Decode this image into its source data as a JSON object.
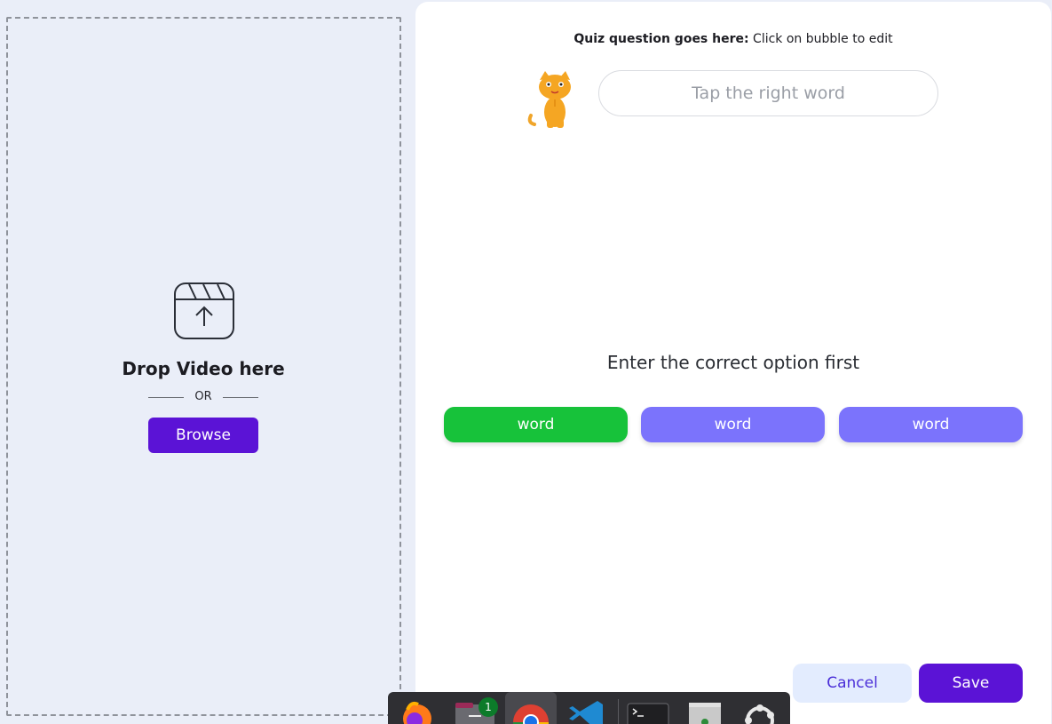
{
  "upload": {
    "title": "Drop Video here",
    "or_text": "OR",
    "browse_label": "Browse",
    "icon": "video-upload-icon"
  },
  "quiz": {
    "question_bold": "Quiz question goes here:",
    "question_rest": " Click on bubble to edit",
    "answer_placeholder": "Tap the right word",
    "hint": "Enter the correct option first",
    "options": [
      {
        "label": "word",
        "state": "correct",
        "color": "#17c23a"
      },
      {
        "label": "word",
        "state": "option",
        "color": "#7b73fc"
      },
      {
        "label": "word",
        "state": "option",
        "color": "#7b73fc"
      }
    ],
    "mascot": "cat-icon"
  },
  "actions": {
    "cancel_label": "Cancel",
    "save_label": "Save"
  },
  "dock": {
    "items": [
      "firefox-icon",
      "files-icon",
      "chrome-icon",
      "vscode-icon",
      "terminal-icon",
      "trash-icon",
      "ubuntu-icon"
    ],
    "files_badge": "1"
  },
  "colors": {
    "primary": "#5b13d6",
    "correct": "#17c23a",
    "option": "#7b73fc",
    "panel_bg": "#eaeef8"
  }
}
